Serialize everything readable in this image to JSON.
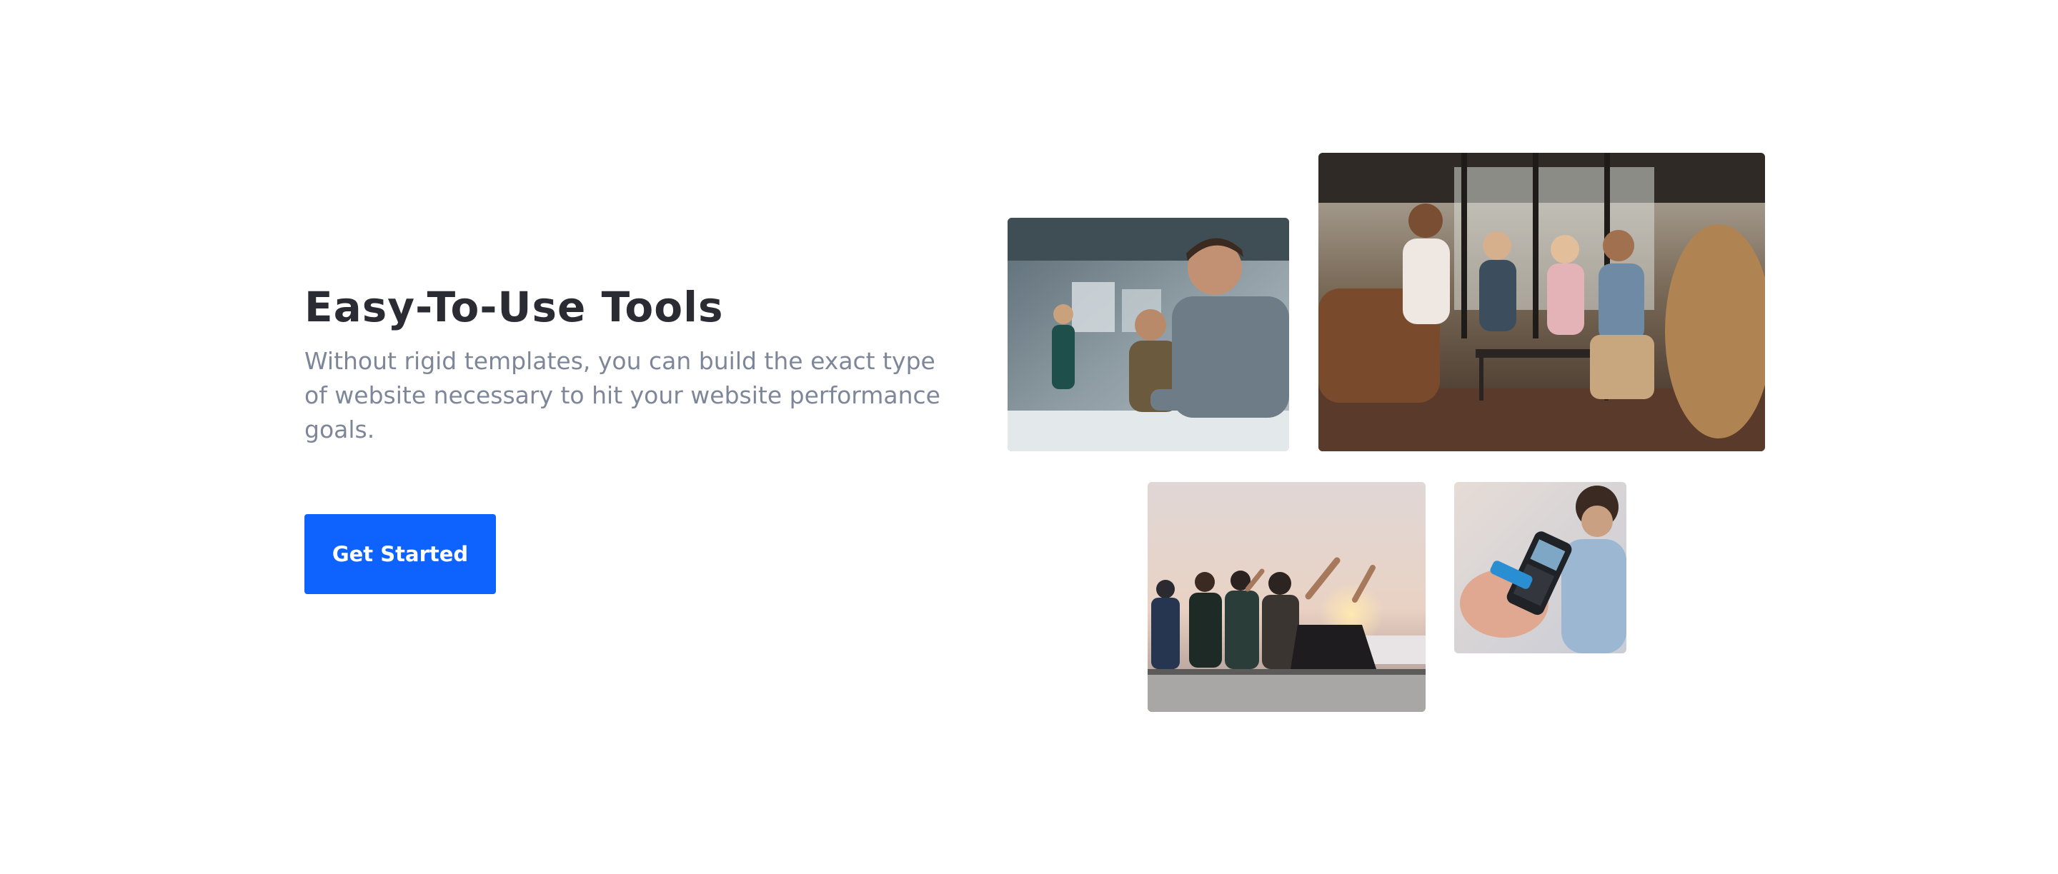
{
  "hero": {
    "title": "Easy-To-Use Tools",
    "description": "Without rigid templates, you can build the exact type of website necessary to hit your website performance goals.",
    "cta_label": "Get Started"
  },
  "colors": {
    "accent": "#0e63ff",
    "title": "#2a2b33",
    "body_text": "#7e8799"
  },
  "gallery": {
    "photos": [
      {
        "name": "office-meeting-photo"
      },
      {
        "name": "team-lounge-discussion-photo"
      },
      {
        "name": "friends-rooftop-sunset-photo"
      },
      {
        "name": "card-payment-terminal-photo"
      }
    ]
  }
}
